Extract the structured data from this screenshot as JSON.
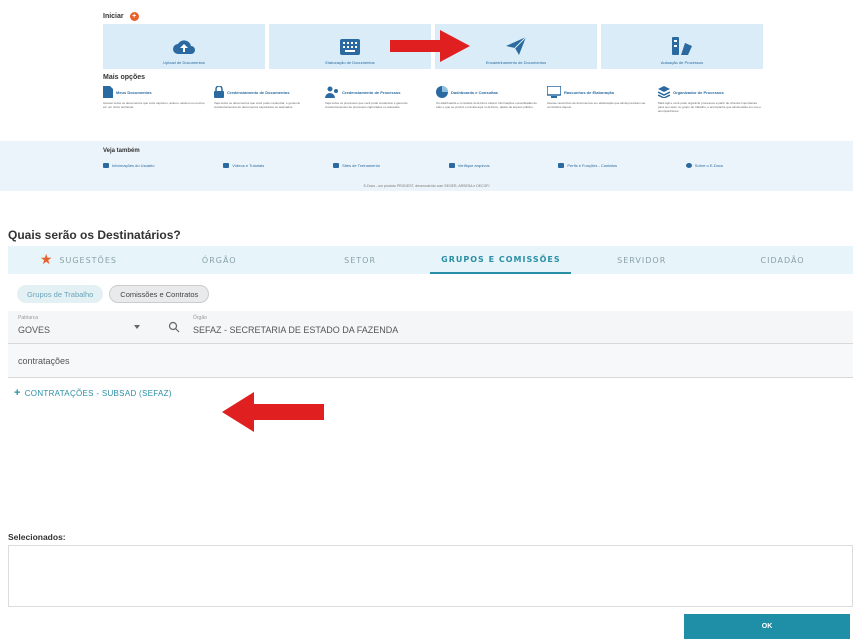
{
  "portal": {
    "iniciar": "Iniciar",
    "tiles": [
      {
        "label": "Upload de Documentos",
        "icon": "cloud-upload-icon"
      },
      {
        "label": "Elaboração de Documentos",
        "icon": "keyboard-icon"
      },
      {
        "label": "Encaminhamento de Documentos",
        "icon": "paper-plane-icon"
      },
      {
        "label": "Autuação de Processos",
        "icon": "file-pages-icon"
      }
    ],
    "mais_opcoes": "Mais opções",
    "options": [
      {
        "title": "Meus Documentos",
        "desc": "Acesse todos os documentos que você capturou, autuou, assinou ou enviou, em um único ambiente."
      },
      {
        "title": "Credenciamento de Documentos",
        "desc": "Veja todos os documentos que você pode credenciar, e gerencie credenciamentos de documentos capturados ou assinados."
      },
      {
        "title": "Credenciamento de Processos",
        "desc": "Veja todos os processos que você pode credenciar e gerencie credenciamentos de processos capturados ou autuados."
      },
      {
        "title": "Dashboards e Consultas",
        "desc": "Os dashboards e consultas do E-Docs trazem informações consolidadas de tudo o que se produz e tramita aqui no E-Docs, dados de acesso público."
      },
      {
        "title": "Rascunhos de Elaboração",
        "desc": "Acesse rascunhos de documentos em elaboração que ainda precisam ser concluídos depois."
      },
      {
        "title": "Organizador de Processos",
        "desc": "Mais ágil e você pode organizar processos a partir de critérios importantes para seu setor ou grupo de trabalho, e acompanhe que ainda estão em uso e acompanhá-los."
      }
    ],
    "veja_tambem": "Veja também",
    "links": [
      "Informações do Usuário",
      "Vídeos e Tutoriais",
      "Sites de Treinamento",
      "Verifique arquivos",
      "Perfis e Funções - Contatos",
      "Sobre o E-Docs"
    ],
    "footer": "E-Docs - um produto PRODEST, desenvolvido com SEGER, ARSESA e DECOFI"
  },
  "destinatarios": {
    "title": "Quais serão os Destinatários?",
    "tabs": [
      "SUGESTÕES",
      "ÓRGÃO",
      "SETOR",
      "GRUPOS E COMISSÕES",
      "SERVIDOR",
      "CIDADÃO"
    ],
    "chips": [
      "Grupos de Trabalho",
      "Comissões e Contratos"
    ],
    "patriarca_label": "Patriarca",
    "patriarca_value": "GOVES",
    "orgao_label": "Órgão",
    "orgao_value": "SEFAZ - SECRETARIA DE ESTADO DA FAZENDA",
    "search_value": "contratações",
    "result": "CONTRATAÇÕES - SUBSAD (SEFAZ)",
    "selecionados": "Selecionados:",
    "ok": "OK"
  },
  "colors": {
    "accent": "#1f8fa8",
    "arrow": "#e02020",
    "tile_bg": "#d9ecf7"
  }
}
